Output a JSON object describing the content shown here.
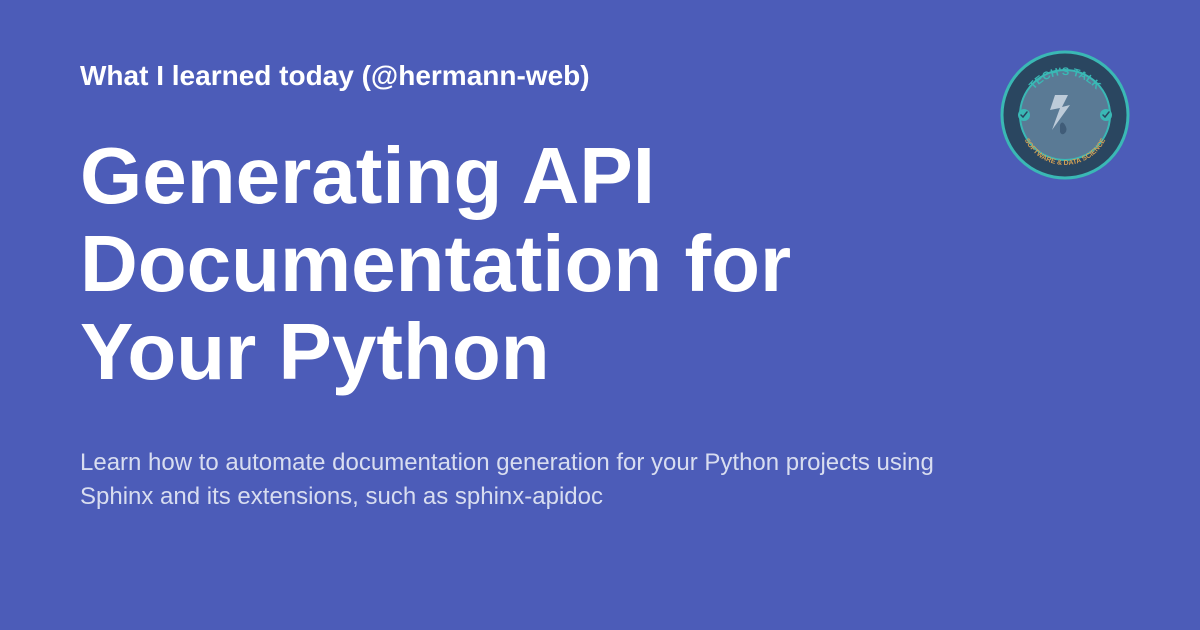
{
  "header": "What I learned today (@hermann-web)",
  "title": "Generating API Documentation for Your Python",
  "description": "Learn how to automate documentation generation for your Python projects using Sphinx and its extensions, such as sphinx-apidoc",
  "logo": {
    "top_text": "TECH'S TALK",
    "bottom_text": "SOFTWARE & DATA SCIENCE"
  }
}
